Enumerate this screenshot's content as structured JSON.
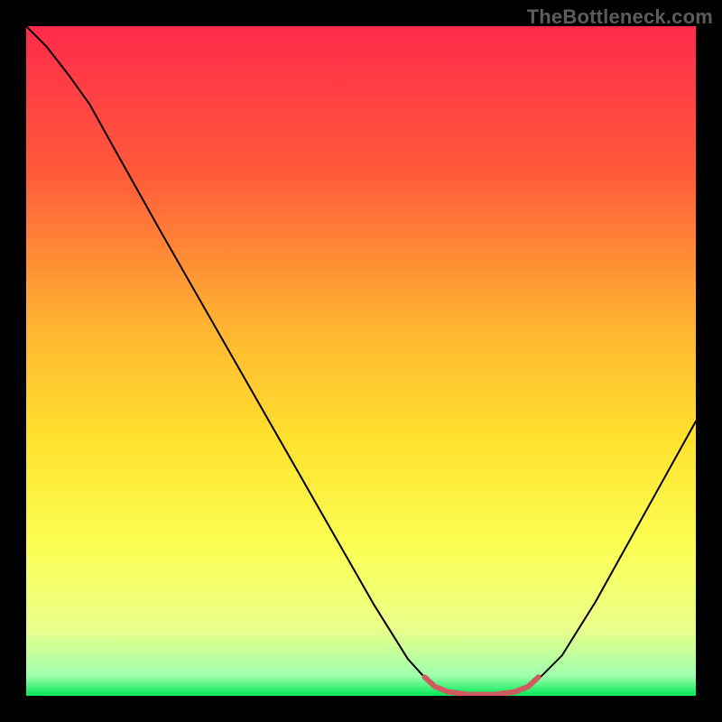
{
  "watermark": "TheBottleneck.com",
  "chart_data": {
    "type": "line",
    "title": "",
    "xlabel": "",
    "ylabel": "",
    "xlim": [
      0,
      100
    ],
    "ylim": [
      0,
      100
    ],
    "gradient_stops": [
      {
        "offset": 0,
        "color": "#ff2a4b"
      },
      {
        "offset": 22,
        "color": "#ff5a3a"
      },
      {
        "offset": 45,
        "color": "#ffb531"
      },
      {
        "offset": 62,
        "color": "#ffe22e"
      },
      {
        "offset": 78,
        "color": "#fbff55"
      },
      {
        "offset": 90,
        "color": "#eaff8a"
      },
      {
        "offset": 97,
        "color": "#9fffad"
      },
      {
        "offset": 100,
        "color": "#00e856"
      }
    ],
    "series": [
      {
        "name": "curve",
        "color": "#000000",
        "width": 2,
        "points": [
          {
            "x": 0.0,
            "y": 100.0
          },
          {
            "x": 3.0,
            "y": 97.0
          },
          {
            "x": 6.5,
            "y": 92.5
          },
          {
            "x": 9.5,
            "y": 88.3
          },
          {
            "x": 13.0,
            "y": 82.0
          },
          {
            "x": 20.0,
            "y": 69.5
          },
          {
            "x": 28.0,
            "y": 55.5
          },
          {
            "x": 36.0,
            "y": 41.5
          },
          {
            "x": 44.0,
            "y": 27.5
          },
          {
            "x": 52.0,
            "y": 13.5
          },
          {
            "x": 57.0,
            "y": 5.5
          },
          {
            "x": 60.0,
            "y": 2.2
          },
          {
            "x": 63.0,
            "y": 0.5
          },
          {
            "x": 68.0,
            "y": 0.0
          },
          {
            "x": 73.0,
            "y": 0.5
          },
          {
            "x": 76.0,
            "y": 2.0
          },
          {
            "x": 80.0,
            "y": 6.0
          },
          {
            "x": 85.0,
            "y": 14.0
          },
          {
            "x": 90.0,
            "y": 23.0
          },
          {
            "x": 95.0,
            "y": 32.0
          },
          {
            "x": 100.0,
            "y": 41.0
          }
        ]
      },
      {
        "name": "optimal-range-marker",
        "color": "#cf5a5f",
        "width": 6,
        "points": [
          {
            "x": 59.5,
            "y": 2.8
          },
          {
            "x": 61.0,
            "y": 1.4
          },
          {
            "x": 63.0,
            "y": 0.6
          },
          {
            "x": 66.0,
            "y": 0.2
          },
          {
            "x": 70.0,
            "y": 0.2
          },
          {
            "x": 73.0,
            "y": 0.6
          },
          {
            "x": 75.0,
            "y": 1.4
          },
          {
            "x": 76.5,
            "y": 2.8
          }
        ]
      }
    ]
  }
}
